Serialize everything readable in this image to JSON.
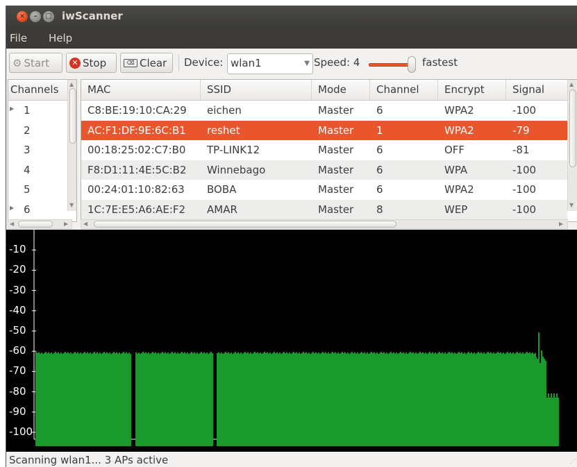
{
  "window": {
    "title": "iwScanner"
  },
  "menu": [
    "File",
    "Help"
  ],
  "toolbar": {
    "start_label": "Start",
    "stop_label": "Stop",
    "clear_label": "Clear",
    "device_label": "Device:",
    "device_value": "wlan1",
    "speed_label": "Speed: 4",
    "speed_value": 4,
    "speed_max_label": "fastest"
  },
  "channels": {
    "header": "Channels",
    "items": [
      {
        "num": "1",
        "expandable": true
      },
      {
        "num": "2",
        "expandable": false
      },
      {
        "num": "3",
        "expandable": false
      },
      {
        "num": "4",
        "expandable": false
      },
      {
        "num": "5",
        "expandable": false
      },
      {
        "num": "6",
        "expandable": true
      }
    ]
  },
  "ap_table": {
    "columns": [
      "MAC",
      "SSID",
      "Mode",
      "Channel",
      "Encrypt",
      "Signal"
    ],
    "rows": [
      {
        "mac": "C8:BE:19:10:CA:29",
        "ssid": "eichen",
        "mode": "Master",
        "channel": "6",
        "encrypt": "WPA2",
        "signal": "-100"
      },
      {
        "mac": "AC:F1:DF:9E:6C:B1",
        "ssid": "reshet",
        "mode": "Master",
        "channel": "1",
        "encrypt": "WPA2",
        "signal": "-79"
      },
      {
        "mac": "00:18:25:02:C7:B0",
        "ssid": "TP-LINK12",
        "mode": "Master",
        "channel": "6",
        "encrypt": "OFF",
        "signal": "-81"
      },
      {
        "mac": "F8:D1:11:4E:5C:B2",
        "ssid": "Winnebago",
        "mode": "Master",
        "channel": "6",
        "encrypt": "WPA",
        "signal": "-100"
      },
      {
        "mac": "00:24:01:10:82:63",
        "ssid": "BOBA",
        "mode": "Master",
        "channel": "6",
        "encrypt": "WPA2",
        "signal": "-100"
      },
      {
        "mac": "1C:7E:E5:A6:AE:F2",
        "ssid": "AMAR",
        "mode": "Master",
        "channel": "8",
        "encrypt": "WEP",
        "signal": "-100"
      }
    ],
    "selected_index": 1
  },
  "graph": {
    "y_ticks": [
      "-10",
      "-20",
      "-30",
      "-40",
      "-50",
      "-60",
      "-70",
      "-80",
      "-90",
      "-100"
    ],
    "colors": {
      "background": "#000000",
      "bar": "#1a9a2c",
      "axis": "#ffffff"
    }
  },
  "colors": {
    "accent": "#e9562d",
    "titlebar": "#3c3b37"
  },
  "status": {
    "text": "Scanning wlan1... 3 APs active"
  }
}
